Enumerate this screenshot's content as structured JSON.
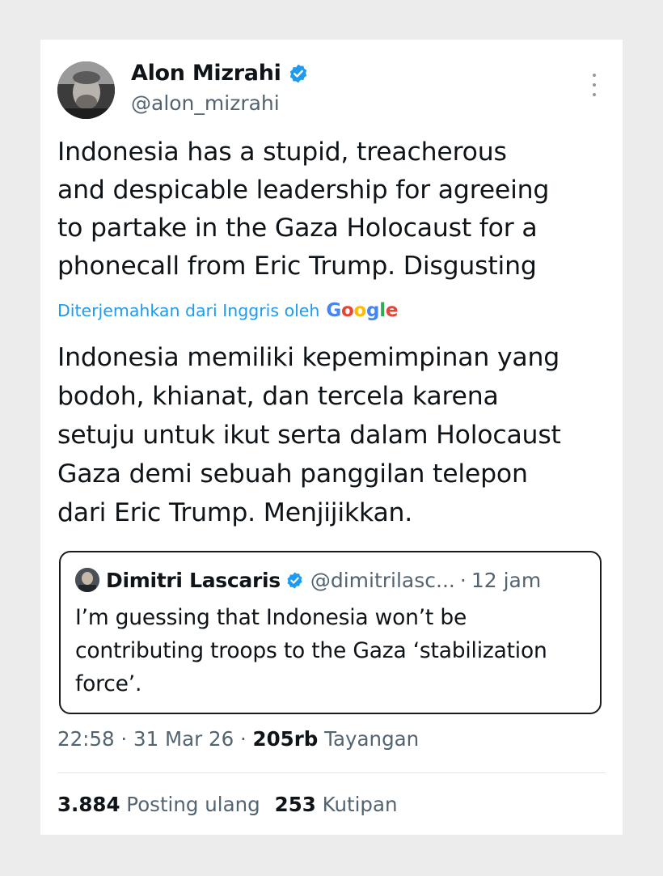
{
  "tweet": {
    "author_name": "Alon Mizrahi",
    "author_handle": "@alon_mizrahi",
    "text": "Indonesia has a stupid, treacherous\nand despicable leadership for agreeing\nto partake in the Gaza Holocaust for a\nphonecall from Eric Trump. Disgusting",
    "translated_label": "Diterjemahkan dari Inggris oleh",
    "translator": {
      "g1": "G",
      "o1": "o",
      "o2": "o",
      "g2": "g",
      "l": "l",
      "e": "e"
    },
    "translation": "Indonesia memiliki kepemimpinan yang\nbodoh, khianat, dan tercela karena\nsetuju untuk ikut serta dalam Holocaust\nGaza demi sebuah panggilan telepon\ndari Eric Trump. Menjijikkan."
  },
  "quote": {
    "author_name": "Dimitri Lascaris",
    "author_handle": "@dimitrilasc...",
    "separator": "·",
    "time": "12 jam",
    "text": "I’m guessing that Indonesia won’t be\ncontributing troops to the Gaza ‘stabilization\nforce’."
  },
  "meta": {
    "time": "22:58",
    "sep1": "·",
    "date": "31 Mar 26",
    "sep2": "·",
    "views_count": "205rb",
    "views_label": "Tayangan"
  },
  "stats": {
    "reposts_count": "3.884",
    "reposts_label": "Posting ulang",
    "quotes_count": "253",
    "quotes_label": "Kutipan"
  },
  "colors": {
    "verified": "#1d9bf0",
    "link": "#1d9bf0",
    "secondary_text": "#536471",
    "primary_text": "#0f1419"
  }
}
